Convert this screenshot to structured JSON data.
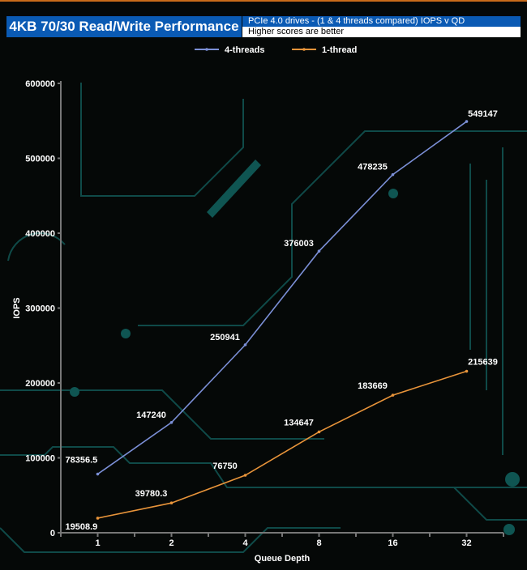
{
  "chart_data": {
    "type": "line",
    "title": "4KB 70/30 Read/Write Performance",
    "subtitle": "PCIe 4.0 drives - (1 & 4 threads compared) IOPS v QD",
    "note": "Higher scores are better",
    "xlabel": "Queue Depth",
    "ylabel": "IOPS",
    "categories": [
      "1",
      "2",
      "4",
      "8",
      "16",
      "32"
    ],
    "ylim": [
      0,
      600000
    ],
    "yticks": [
      "0",
      "100000",
      "200000",
      "300000",
      "400000",
      "500000",
      "600000"
    ],
    "legend_position": "top",
    "series": [
      {
        "name": "4-threads",
        "color": "#7b8fd6",
        "values": [
          78356.5,
          147240,
          250941,
          376003,
          478235,
          549147
        ],
        "labels": [
          "78356.5",
          "147240",
          "250941",
          "376003",
          "478235",
          "549147"
        ]
      },
      {
        "name": "1-thread",
        "color": "#e8943a",
        "values": [
          19508.9,
          39780.3,
          76750,
          134647,
          183669,
          215639
        ],
        "labels": [
          "19508.9",
          "39780.3",
          "76750",
          "134647",
          "183669",
          "215639"
        ]
      }
    ]
  }
}
